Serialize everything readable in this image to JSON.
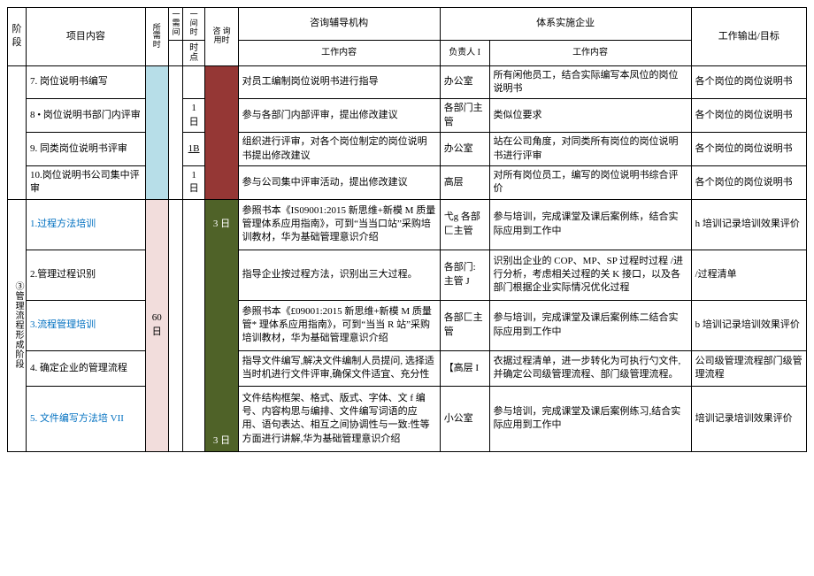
{
  "header": {
    "stage": "阶段",
    "item": "项目内容",
    "needTime": "所需时",
    "gapTop": "一需间",
    "timePt": "一间时",
    "gapBot": "时点",
    "consultOrg": "咨询辅导机构",
    "useTime": "咨 询用时",
    "consultWork": "工作内容",
    "implEnterprise": "体系实施企业",
    "owner": "负责人 I",
    "enterpriseWork": "工作内容",
    "output": "工作输出/目标"
  },
  "stageLabel": "③管理流程形成阶段",
  "rows": [
    {
      "id": "r7",
      "item": "7. 岗位说明书编写",
      "need": "",
      "timePt": "",
      "useTime": "",
      "cwork": "对员工编制岗位说明书进行指导",
      "owner": "办公室",
      "ework": "所有闲他员工，结合实际编写本凤位的岗位说明书",
      "output": "各个岗位的岗位说明书"
    },
    {
      "id": "r8",
      "item": "8 • 岗位说明书部门内评审",
      "need": "",
      "timePt": "1 日",
      "useTime": "",
      "cwork": "参与各部门内部评审，提出修改建议",
      "owner": "各部门主管",
      "ework": "类似位要求",
      "output": "各个岗位的岗位说明书"
    },
    {
      "id": "r9",
      "item": "9. 同类岗位说明书评审",
      "need": "",
      "timePt": "1B",
      "useTime": "",
      "cwork": "组织进行评审，对各个岗位制定的岗位说明书提出修改建议",
      "owner": "办公室",
      "ework": "站在公司角度，对同类所有岗位的岗位说明书进行评审",
      "output": "各个岗位的岗位说明书"
    },
    {
      "id": "r10",
      "item": "10.岗位说明书公司集中评审",
      "need": "",
      "timePt": "1 日",
      "useTime": "",
      "cwork": "参与公司集中评审活动，提出修改建议",
      "owner": "高层",
      "ework": "对所有岗位员工，编写的岗位说明书综合评价",
      "output": "各个岗位的岗位说明书"
    },
    {
      "id": "s1",
      "item": "1.过程方法培训",
      "need": "60 日",
      "timePt": "",
      "useTime": "3 日",
      "cwork": "参照书本《IS09001:2015 新思维+新模 M 质量管理体系应用指南》，可到“当当口站”采购培训教材，华为基础管理意识介绍",
      "owner": "弋g 各部匚主管",
      "ework": "参与培训，完成课堂及课后案例练，结合实际应用到工作中",
      "output": "h 培训记录培训效果评价"
    },
    {
      "id": "s2",
      "item": "2.管理过程识别",
      "need": "",
      "timePt": "",
      "useTime": "",
      "cwork": "指导企业按过程方法，识别出三大过程。",
      "owner": "各部门:主管 J",
      "ework": "识别出企业的 COP、MP、SP 过程时过程 /进行分析，考虑相关过程的关 K 接口，以及各部门根据企业实际情况优化过程",
      "output": "/过程清单"
    },
    {
      "id": "s3",
      "item": "3.流程管理培训",
      "need": "",
      "timePt": "",
      "useTime": "",
      "cwork": "参照书本《£09001:2015 新思维+新模 M 质量管* 理体系应用指南》，可到“当当 R 站”采购培训教材，华为基础管理意识介绍",
      "owner": "各部匚主管",
      "ework": "参与培训，完成课堂及课后案例练二结合实际应用到工作中",
      "output": "b 培训记录培训效果评价"
    },
    {
      "id": "s4",
      "item": "4. 确定企业的管理流程",
      "need": "",
      "timePt": "",
      "useTime": "",
      "cwork": "指导文件编写,解决文件编制人员提问, 选择适当时机进行文件评审,确保文件适宜、充分性",
      "owner": "【高层 I",
      "ework": "衣据过程清单，进一步转化为可执行勺文件,并确定公司级管理流程、部门级管理流程。",
      "output": "公司级管理流程部门级管理流程"
    },
    {
      "id": "s5",
      "item": "5. 文件编写方法培 VII",
      "need": "",
      "timePt": "",
      "useTime": "3 日",
      "cwork": "文件结构框架、格式、版式、字体、文 f 编号、内容构思与编排、文件编写词语的应用、语句表达、相互之间协调性与一致:性等方面进行讲解,华为基础管理意识介绍",
      "owner": "小公室",
      "ework": "参与培训，完成课堂及课后案例练习,结合实际应用到工作中",
      "output": "培训记录培训效果评价"
    }
  ]
}
